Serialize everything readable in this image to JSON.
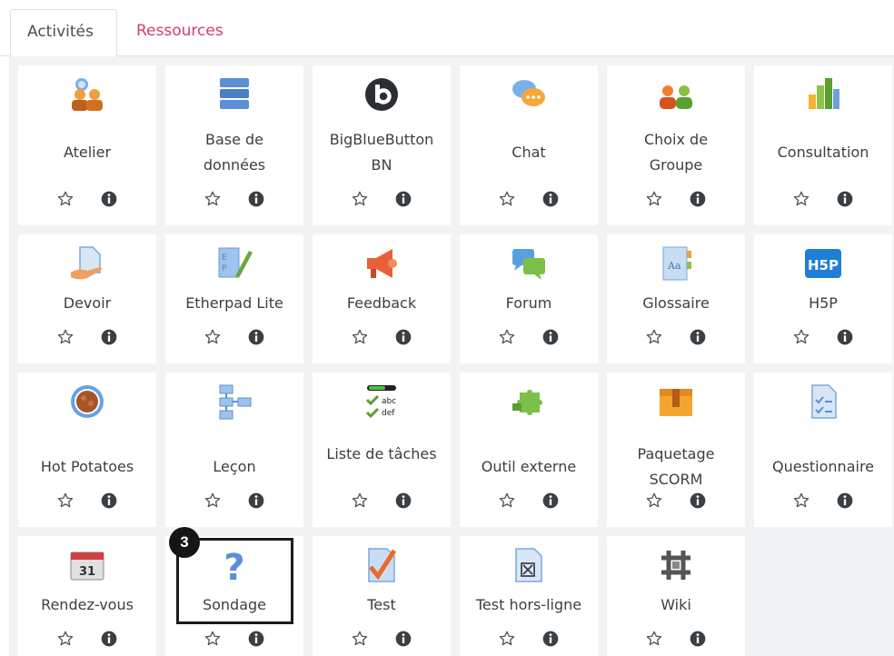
{
  "tabs": [
    {
      "label": "Activités",
      "active": true
    },
    {
      "label": "Ressources",
      "active": false
    }
  ],
  "activities": [
    {
      "label": "Atelier",
      "icon": "workshop-icon"
    },
    {
      "label": "Base de données",
      "icon": "database-icon"
    },
    {
      "label": "BigBlueButton BN",
      "icon": "bigbluebutton-icon"
    },
    {
      "label": "Chat",
      "icon": "chat-icon"
    },
    {
      "label": "Choix de Groupe",
      "icon": "group-choice-icon"
    },
    {
      "label": "Consultation",
      "icon": "consultation-icon"
    },
    {
      "label": "Devoir",
      "icon": "assignment-icon"
    },
    {
      "label": "Etherpad Lite",
      "icon": "etherpad-icon"
    },
    {
      "label": "Feedback",
      "icon": "feedback-icon"
    },
    {
      "label": "Forum",
      "icon": "forum-icon"
    },
    {
      "label": "Glossaire",
      "icon": "glossary-icon"
    },
    {
      "label": "H5P",
      "icon": "h5p-icon"
    },
    {
      "label": "Hot Potatoes",
      "icon": "hot-potatoes-icon"
    },
    {
      "label": "Leçon",
      "icon": "lesson-icon"
    },
    {
      "label": "Liste de tâches",
      "icon": "checklist-icon"
    },
    {
      "label": "Outil externe",
      "icon": "external-tool-icon"
    },
    {
      "label": "Paquetage SCORM",
      "icon": "scorm-icon"
    },
    {
      "label": "Questionnaire",
      "icon": "questionnaire-icon"
    },
    {
      "label": "Rendez-vous",
      "icon": "calendar-icon"
    },
    {
      "label": "Sondage",
      "icon": "survey-icon"
    },
    {
      "label": "Test",
      "icon": "quiz-icon"
    },
    {
      "label": "Test hors-ligne",
      "icon": "offline-quiz-icon"
    },
    {
      "label": "Wiki",
      "icon": "wiki-icon"
    }
  ],
  "callout": {
    "number": "3",
    "target": "Sondage"
  },
  "colors": {
    "accent_tab": "#d63c6c",
    "tile_bg": "#ffffff",
    "grid_bg": "#f2f3f4"
  }
}
